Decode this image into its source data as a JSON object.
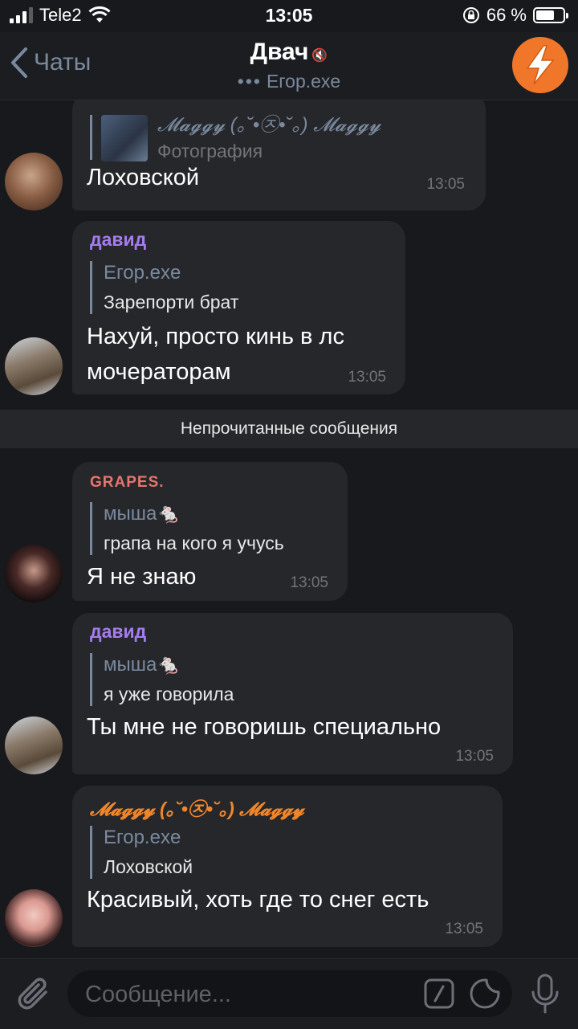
{
  "status_bar": {
    "carrier": "Tele2",
    "time": "13:05",
    "battery_percent": "66 %"
  },
  "header": {
    "back_label": "Чаты",
    "title": "Двач",
    "subtitle": "Егор.exe"
  },
  "messages": [
    {
      "reply_name": "𝓜𝓪𝓰𝓰𝔂 (｡˘•㉨•˘｡) 𝓜𝓪𝓰𝓰𝔂",
      "reply_text": "Фотография",
      "text": "Лоховской",
      "time": "13:05"
    },
    {
      "sender": "давид",
      "sender_color": "#a57cf0",
      "reply_name": "Егор.exe",
      "reply_text": "Зарепорти брат",
      "text_lines": [
        "Нахуй, просто кинь в лс",
        "мочераторам"
      ],
      "time": "13:05"
    },
    {
      "sender": "GRAPES.",
      "sender_color": "#e9746e",
      "reply_name": "мыша🐁",
      "reply_text": "грапа на кого я учусь",
      "text": "Я не знаю",
      "time": "13:05"
    },
    {
      "sender": "давид",
      "sender_color": "#a57cf0",
      "reply_name": "мыша🐁",
      "reply_text": "я уже говорила",
      "text": "Ты мне не говоришь специально",
      "time": "13:05"
    },
    {
      "sender": "𝓜𝓪𝓰𝓰𝔂 (｡˘•㉨•˘｡) 𝓜𝓪𝓰𝓰𝔂",
      "sender_color": "#f0862a",
      "reply_name": "Егор.exe",
      "reply_text": "Лоховской",
      "text": "Красивый, хоть где то снег есть",
      "time": "13:05"
    }
  ],
  "unread_divider": "Непрочитанные сообщения",
  "input": {
    "placeholder": "Сообщение..."
  },
  "colors": {
    "background": "#18191d",
    "bubble": "#26272b",
    "accent": "#7a8a9e",
    "logo": "#f0772a"
  },
  "icons": [
    "signal-icon",
    "wifi-icon",
    "orientation-lock-icon",
    "battery-icon",
    "back-chevron-icon",
    "mute-icon",
    "lightning-logo",
    "attach-icon",
    "commands-icon",
    "sticker-icon",
    "microphone-icon"
  ]
}
